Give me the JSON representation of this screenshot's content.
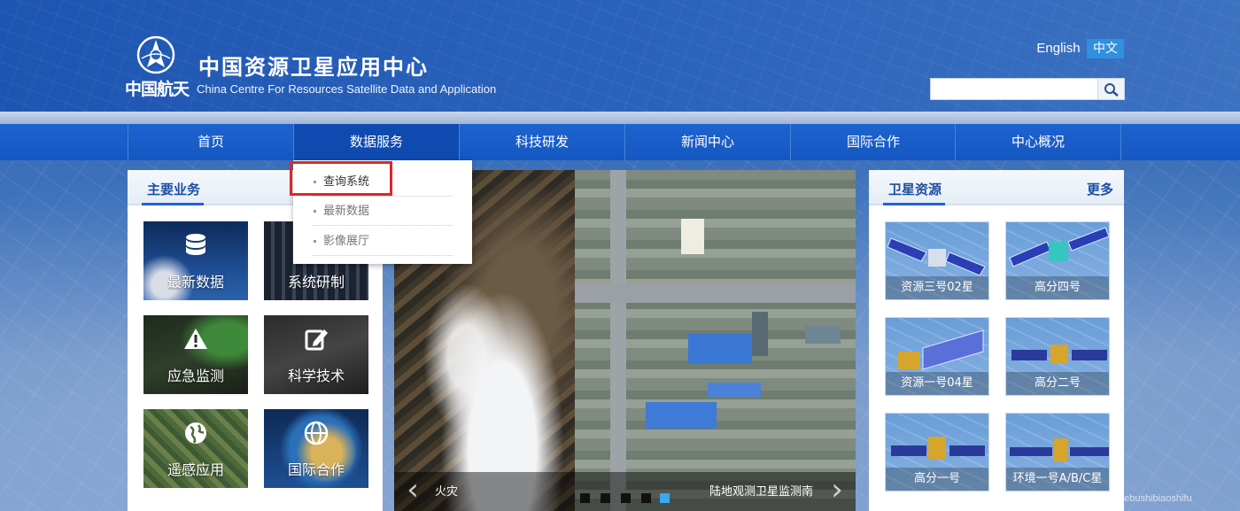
{
  "header": {
    "brand_cn": "中国航天",
    "title_cn": "中国资源卫星应用中心",
    "title_en": "China Centre For Resources Satellite Data and Application",
    "lang_en": "English",
    "lang_cn": "中文",
    "search_value": ""
  },
  "nav": {
    "items": [
      "首页",
      "数据服务",
      "科技研发",
      "新闻中心",
      "国际合作",
      "中心概况"
    ],
    "active_index": 1
  },
  "dropdown": {
    "items": [
      "查询系统",
      "最新数据",
      "影像展厅"
    ],
    "highlighted_index": 0
  },
  "left_panel": {
    "title": "主要业务",
    "tiles": [
      {
        "label": "最新数据",
        "icon": "database-icon"
      },
      {
        "label": "系统研制",
        "icon": "server-icon"
      },
      {
        "label": "应急监测",
        "icon": "warning-icon"
      },
      {
        "label": "科学技术",
        "icon": "edit-icon"
      },
      {
        "label": "遥感应用",
        "icon": "globe-icon"
      },
      {
        "label": "国际合作",
        "icon": "globe-network-icon"
      }
    ]
  },
  "slideshow": {
    "caption_left": "火灾",
    "caption_right": "陆地观测卫星监测南",
    "dot_count": 5,
    "active_dot": 4
  },
  "right_panel": {
    "title": "卫星资源",
    "more": "更多",
    "satellites": [
      "资源三号02星",
      "高分四号",
      "资源一号04星",
      "高分二号",
      "高分一号",
      "环境一号A/B/C星"
    ]
  },
  "watermark": "https://blog.csdn.net/zhebushibiaoshifu",
  "colors": {
    "nav_bg": "#1d63cf",
    "nav_active": "#0f4ab0",
    "highlight_border": "#e0262b",
    "accent_blue": "#1d4fa1",
    "lang_active": "#2f8fe0"
  }
}
